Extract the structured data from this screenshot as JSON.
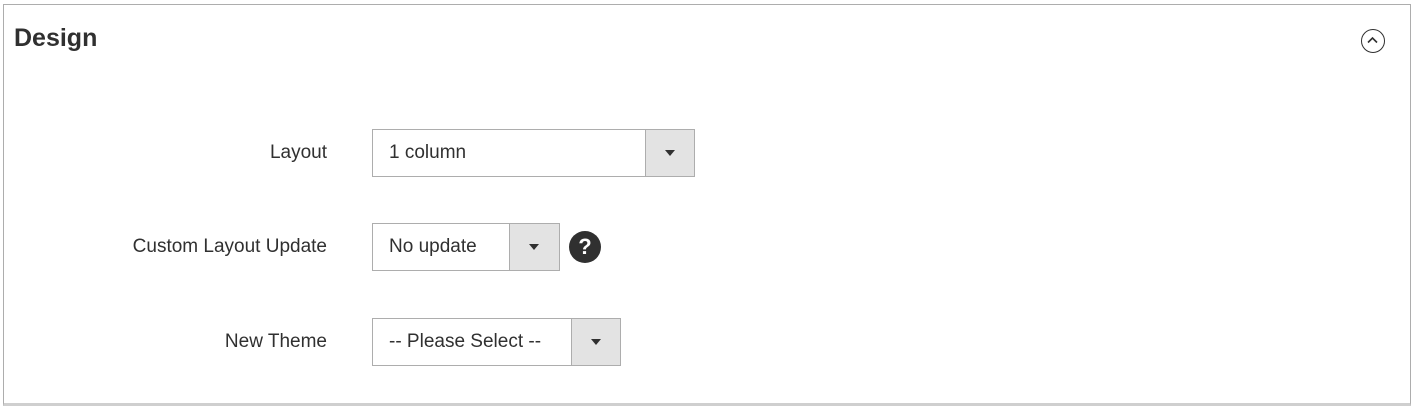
{
  "section": {
    "title": "Design",
    "collapse_icon": "chevron-up-circle-icon"
  },
  "fields": {
    "layout": {
      "label": "Layout",
      "value": "1 column"
    },
    "custom_layout_update": {
      "label": "Custom Layout Update",
      "value": "No update",
      "help_glyph": "?"
    },
    "new_theme": {
      "label": "New Theme",
      "value": "-- Please Select --"
    }
  },
  "colors": {
    "text": "#303030",
    "border": "#adadad",
    "arrow_background": "#e3e3e3"
  }
}
